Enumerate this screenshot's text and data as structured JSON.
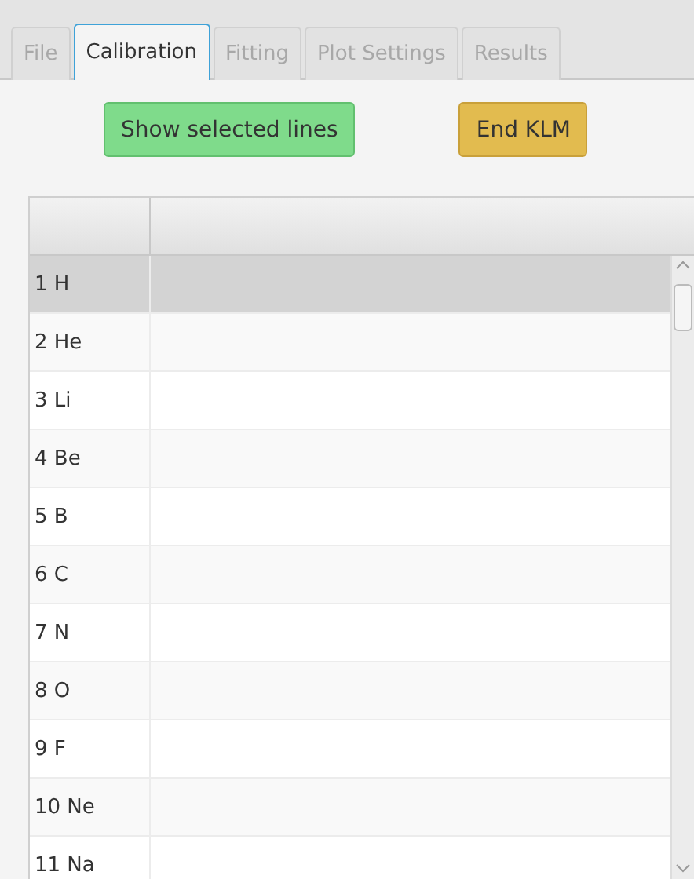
{
  "tabs": [
    {
      "label": "File",
      "selected": false,
      "disabled": true
    },
    {
      "label": "Calibration",
      "selected": true,
      "disabled": false
    },
    {
      "label": "Fitting",
      "selected": false,
      "disabled": true
    },
    {
      "label": "Plot Settings",
      "selected": false,
      "disabled": true
    },
    {
      "label": "Results",
      "selected": false,
      "disabled": true
    }
  ],
  "buttons": [
    {
      "label": "Show selected lines",
      "kind": "success"
    },
    {
      "label": "End KLM",
      "kind": "warning"
    }
  ],
  "table": {
    "rows": [
      {
        "label": "1 H",
        "selected": true
      },
      {
        "label": "2 He",
        "selected": false
      },
      {
        "label": "3 Li",
        "selected": false
      },
      {
        "label": "4 Be",
        "selected": false
      },
      {
        "label": "5 B",
        "selected": false
      },
      {
        "label": "6 C",
        "selected": false
      },
      {
        "label": "7 N",
        "selected": false
      },
      {
        "label": "8 O",
        "selected": false
      },
      {
        "label": "9 F",
        "selected": false
      },
      {
        "label": "10 Ne",
        "selected": false
      },
      {
        "label": "11 Na",
        "selected": false
      }
    ]
  }
}
